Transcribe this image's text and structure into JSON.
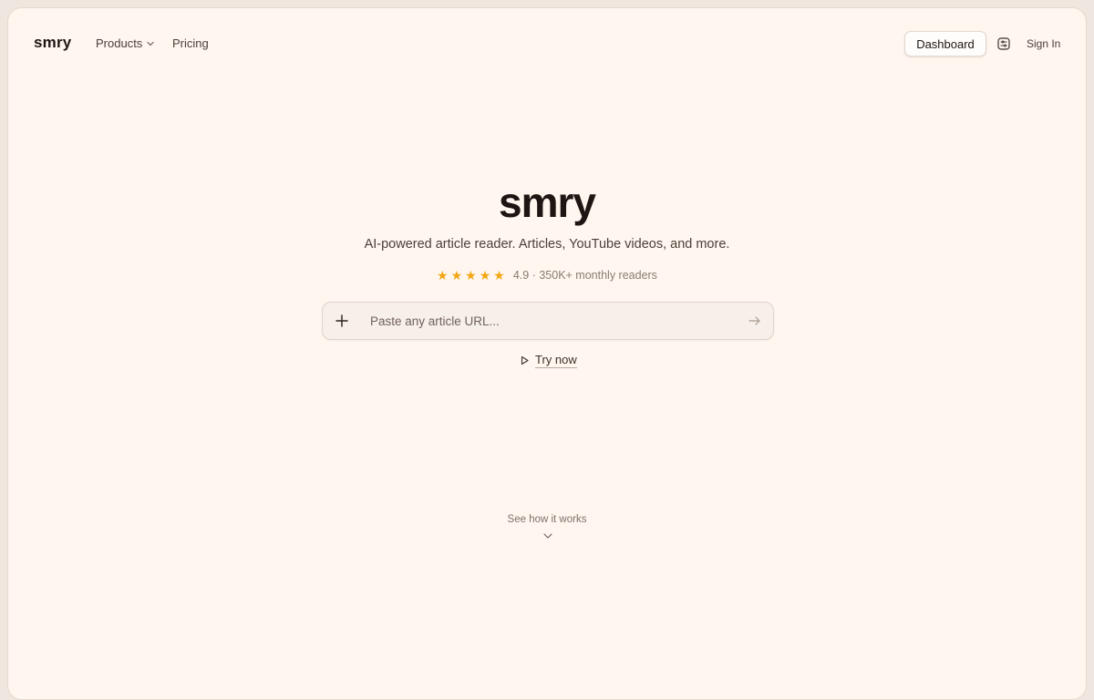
{
  "header": {
    "logo": "smry",
    "nav": {
      "products_label": "Products",
      "pricing_label": "Pricing"
    },
    "dashboard_label": "Dashboard",
    "signin_label": "Sign In"
  },
  "hero": {
    "title": "smry",
    "subtitle": "AI-powered article reader. Articles, YouTube videos, and more.",
    "rating": {
      "stars": 5,
      "text": "4.9 · 350K+ monthly readers"
    }
  },
  "search": {
    "placeholder": "Paste any article URL...",
    "value": ""
  },
  "try_now_label": "Try now",
  "see_how_label": "See how it works",
  "colors": {
    "background": "#fff6f0",
    "star": "#f2a712",
    "text_dark": "#1d1612"
  },
  "icons": {
    "products": "chevron-down-icon",
    "settings": "sliders-icon",
    "add": "plus-icon",
    "submit": "arrow-right-icon",
    "try_now": "play-icon",
    "see_how": "chevron-down-icon"
  }
}
